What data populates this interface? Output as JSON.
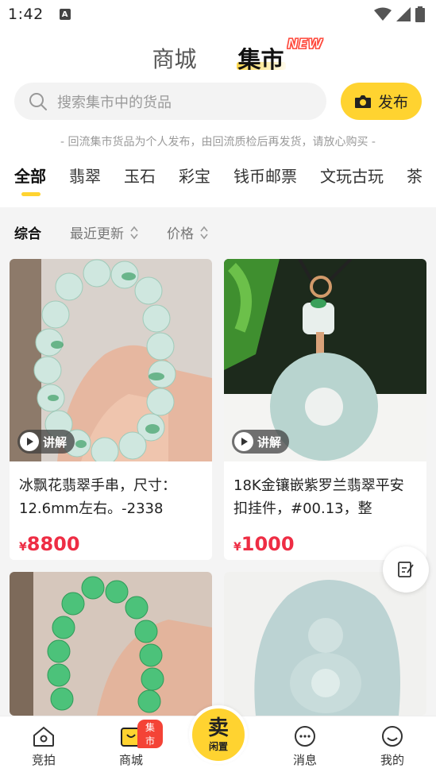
{
  "status": {
    "time": "1:42",
    "a_icon": "A"
  },
  "title_tabs": {
    "tab1": "商城",
    "tab2": "集市",
    "new_badge": "NEW"
  },
  "search": {
    "placeholder": "搜索集市中的货品",
    "publish_label": "发布"
  },
  "notice": "- 回流集市货品为个人发布，由回流质检后再发货，请放心购买 -",
  "categories": [
    "全部",
    "翡翠",
    "玉石",
    "彩宝",
    "钱币邮票",
    "文玩古玩",
    "茶"
  ],
  "sort": {
    "comprehensive": "综合",
    "recent": "最近更新",
    "price": "价格"
  },
  "products": [
    {
      "title": "冰飘花翡翠手串，尺寸：12.6mm左右。-2338",
      "currency": "¥",
      "price": "8800",
      "explain": "讲解"
    },
    {
      "title": "18K金镶嵌紫罗兰翡翠平安扣挂件，#00.13，整",
      "currency": "¥",
      "price": "1000",
      "explain": "讲解"
    }
  ],
  "bottom_nav": {
    "auction": "竞拍",
    "mall": "商城",
    "market_badge": "集市",
    "sell_big": "卖",
    "sell_small": "闲置",
    "messages": "消息",
    "mine": "我的"
  },
  "colors": {
    "accent": "#ffd330",
    "price": "#ee2d44",
    "badge": "#f44336"
  }
}
